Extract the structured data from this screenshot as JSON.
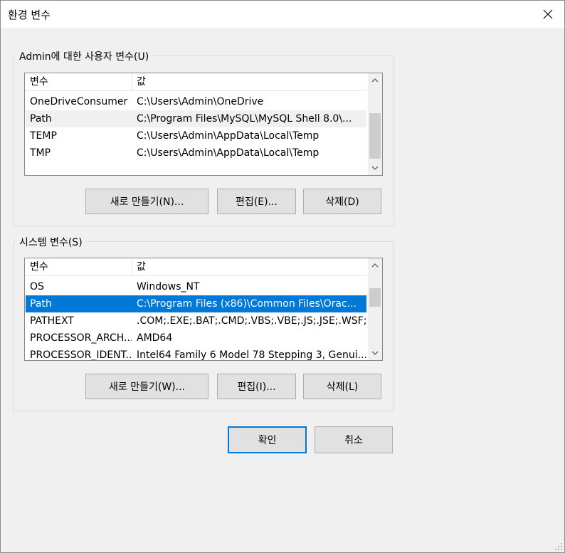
{
  "window": {
    "title": "환경 변수"
  },
  "user_vars": {
    "legend": "Admin에 대한 사용자 변수(U)",
    "columns": [
      "변수",
      "값"
    ],
    "rows": [
      {
        "name": "OneDriveConsumer",
        "value": "C:\\Users\\Admin\\OneDrive"
      },
      {
        "name": "Path",
        "value": "C:\\Program Files\\MySQL\\MySQL Shell 8.0\\..."
      },
      {
        "name": "TEMP",
        "value": "C:\\Users\\Admin\\AppData\\Local\\Temp"
      },
      {
        "name": "TMP",
        "value": "C:\\Users\\Admin\\AppData\\Local\\Temp"
      }
    ],
    "buttons": {
      "new": "새로 만들기(N)...",
      "edit": "편집(E)...",
      "delete": "삭제(D)"
    }
  },
  "system_vars": {
    "legend": "시스템 변수(S)",
    "columns": [
      "변수",
      "값"
    ],
    "rows": [
      {
        "name": "OS",
        "value": "Windows_NT"
      },
      {
        "name": "Path",
        "value": "C:\\Program Files (x86)\\Common Files\\Orac..."
      },
      {
        "name": "PATHEXT",
        "value": ".COM;.EXE;.BAT;.CMD;.VBS;.VBE;.JS;.JSE;.WSF;...."
      },
      {
        "name": "PROCESSOR_ARCH...",
        "value": "AMD64"
      },
      {
        "name": "PROCESSOR_IDENT...",
        "value": "Intel64 Family 6 Model 78 Stepping 3, Genui..."
      }
    ],
    "buttons": {
      "new": "새로 만들기(W)...",
      "edit": "편집(I)...",
      "delete": "삭제(L)"
    }
  },
  "footer": {
    "ok": "확인",
    "cancel": "취소"
  },
  "colors": {
    "selection": "#0078d7",
    "hover_row": "#f0f0f0",
    "button_bg": "#e1e1e1"
  }
}
